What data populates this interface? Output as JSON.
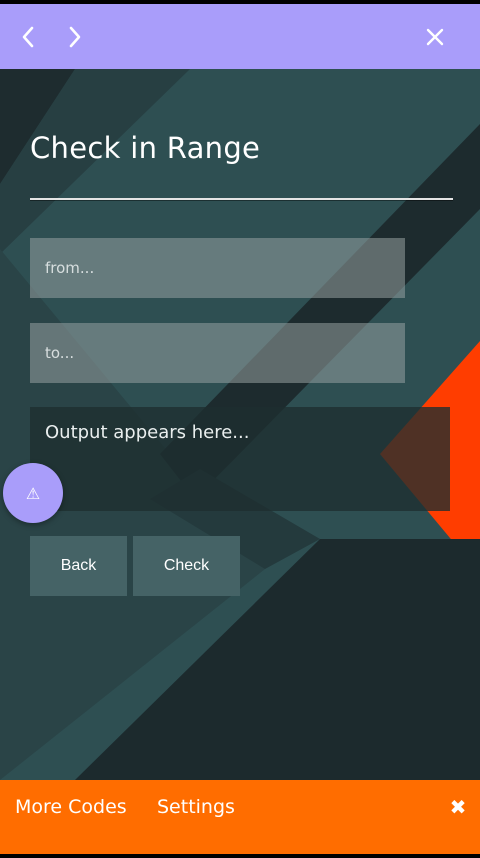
{
  "header": {
    "back_icon": "chevron-left-icon",
    "forward_icon": "chevron-right-icon",
    "close_icon": "close-icon",
    "color": "#a99dfa"
  },
  "main": {
    "title": "Check in Range",
    "from_placeholder": "from...",
    "to_placeholder": "to...",
    "output_text": "Output appears here...",
    "back_label": "Back",
    "check_label": "Check",
    "fab_icon": "warning-icon",
    "fab_glyph": "⚠"
  },
  "footer": {
    "more_codes_label": "More Codes",
    "settings_label": "Settings",
    "close_glyph": "✖",
    "color": "#ff6d00"
  },
  "colors": {
    "background_teal": "#2e4f52",
    "dark_slate": "#1c2a2d",
    "accent_red": "#ff3d00"
  }
}
